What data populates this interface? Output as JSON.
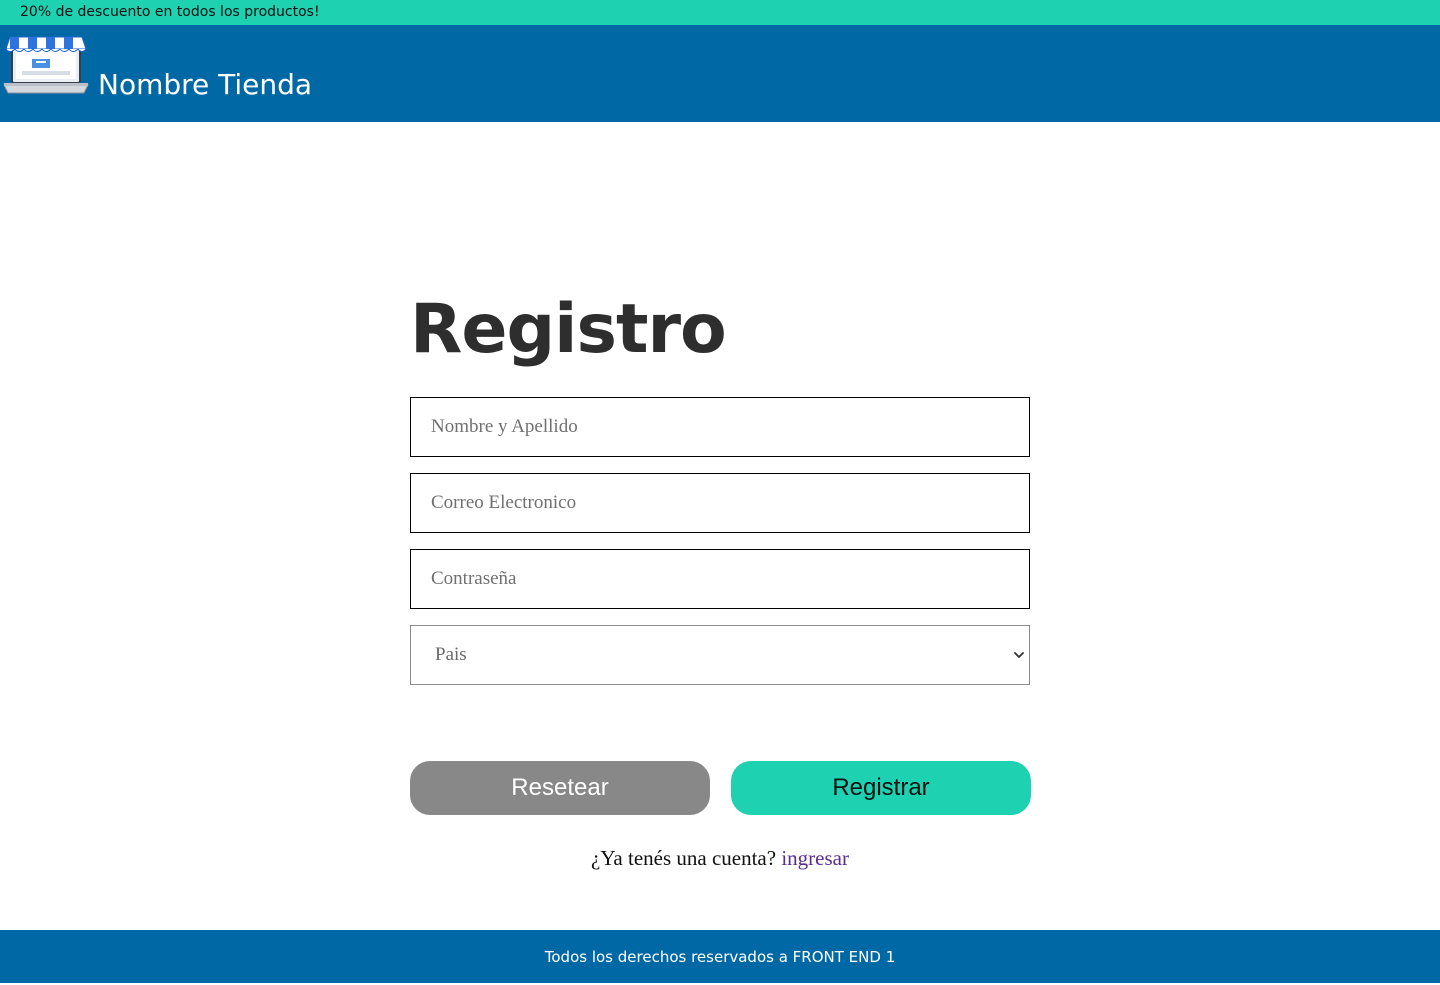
{
  "promo": {
    "text": "20% de descuento en todos los productos!"
  },
  "header": {
    "store_name": "Nombre Tienda",
    "logo_icon": "laptop-store-icon"
  },
  "form": {
    "title": "Registro",
    "name_placeholder": "Nombre y Apellido",
    "email_placeholder": "Correo Electronico",
    "password_placeholder": "Contraseña",
    "country_selected": "Pais",
    "reset_label": "Resetear",
    "register_label": "Registrar",
    "have_account_text": "¿Ya tenés una cuenta?",
    "login_link": "ingresar"
  },
  "footer": {
    "text": "Todos los derechos reservados a FRONT END 1"
  },
  "colors": {
    "promo_bg": "#1dd1b1",
    "header_bg": "#0068a5",
    "reset_bg": "#888888",
    "register_bg": "#1dd1b1",
    "link": "#5b2d8e"
  }
}
